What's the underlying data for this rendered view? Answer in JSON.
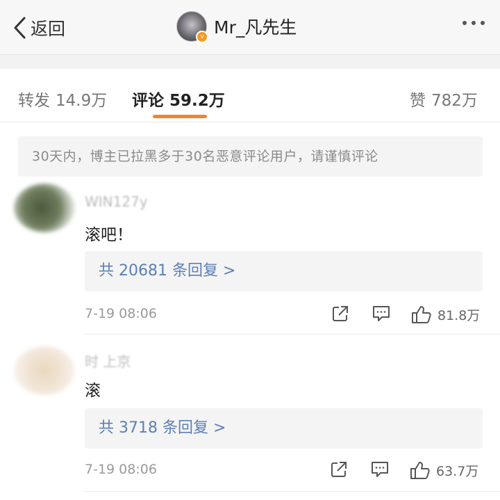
{
  "nav": {
    "back_label": "返回",
    "author_name": "Mr_凡先生",
    "verified_badge": "v"
  },
  "tabs": {
    "repost": {
      "label": "转发",
      "count": "14.9万"
    },
    "comment": {
      "label": "评论",
      "count": "59.2万"
    },
    "like": {
      "label": "赞",
      "count": "782万"
    }
  },
  "notice": "30天内，博主已拉黑多于30名恶意评论用户，请谨慎评论",
  "comments": [
    {
      "name": "WIN127y",
      "text": "滚吧！",
      "replies": "共 20681 条回复 >",
      "time": "7-19 08:06",
      "likes": "81.8万"
    },
    {
      "name": "时 上京",
      "text": "滚",
      "replies": "共 3718 条回复 >",
      "time": "7-19 08:06",
      "likes": "63.7万"
    }
  ],
  "colors": {
    "accent": "#f08532",
    "link": "#5b7fb6"
  }
}
